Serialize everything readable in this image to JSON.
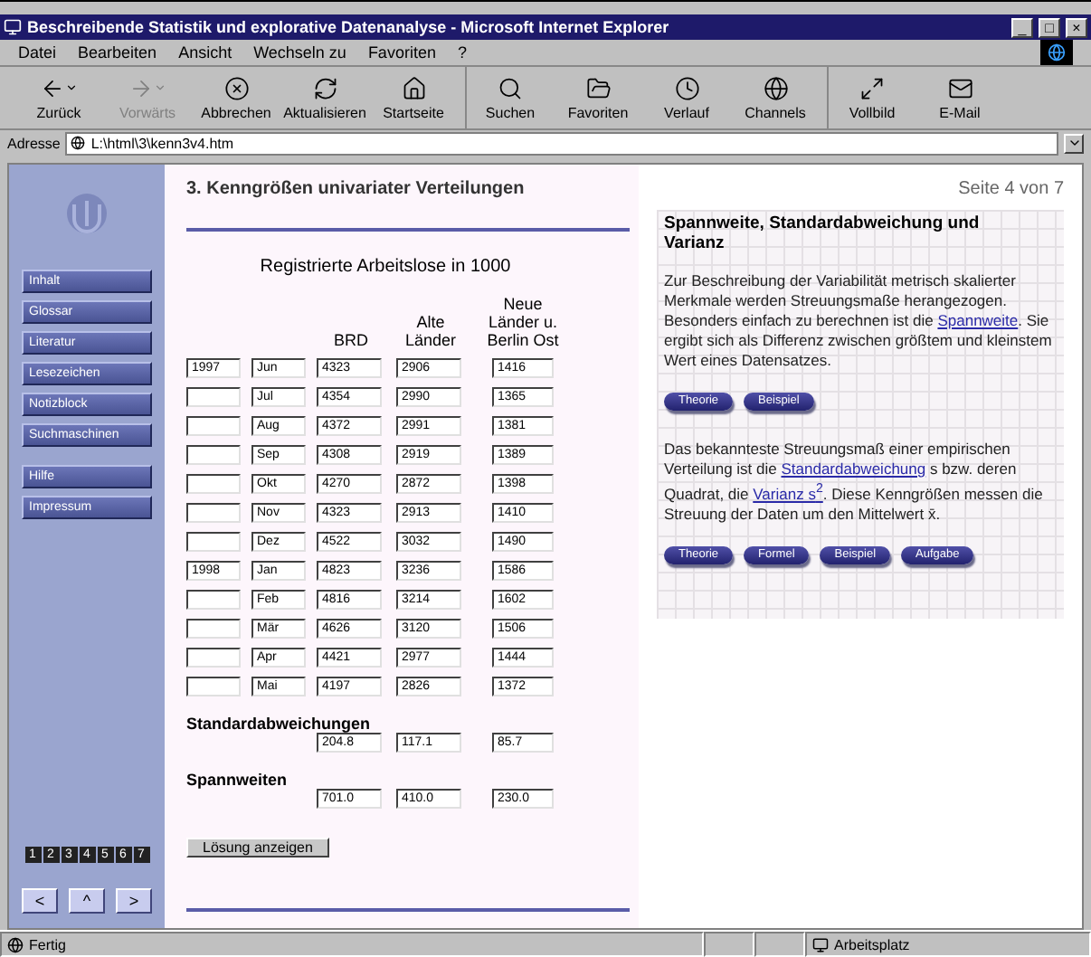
{
  "window": {
    "title": "Beschreibende Statistik und explorative Datenanalyse - Microsoft Internet Explorer",
    "controls": [
      "_",
      "□",
      "×"
    ]
  },
  "menu": [
    "Datei",
    "Bearbeiten",
    "Ansicht",
    "Wechseln zu",
    "Favoriten",
    "?"
  ],
  "toolbar": [
    {
      "label": "Zurück",
      "dropdown": true,
      "disabled": false,
      "group_start": false
    },
    {
      "label": "Vorwärts",
      "dropdown": true,
      "disabled": true,
      "group_start": false
    },
    {
      "label": "Abbrechen",
      "dropdown": false,
      "disabled": false,
      "group_start": false
    },
    {
      "label": "Aktualisieren",
      "dropdown": false,
      "disabled": false,
      "group_start": false
    },
    {
      "label": "Startseite",
      "dropdown": false,
      "disabled": false,
      "group_start": false
    },
    {
      "label": "Suchen",
      "dropdown": false,
      "disabled": false,
      "group_start": true
    },
    {
      "label": "Favoriten",
      "dropdown": false,
      "disabled": false,
      "group_start": false
    },
    {
      "label": "Verlauf",
      "dropdown": false,
      "disabled": false,
      "group_start": false
    },
    {
      "label": "Channels",
      "dropdown": false,
      "disabled": false,
      "group_start": false
    },
    {
      "label": "Vollbild",
      "dropdown": false,
      "disabled": false,
      "group_start": true
    },
    {
      "label": "E-Mail",
      "dropdown": false,
      "disabled": false,
      "group_start": false
    }
  ],
  "address": {
    "label": "Adresse",
    "value": "L:\\html\\3\\kenn3v4.htm"
  },
  "sidebar": {
    "items": [
      {
        "label": "Inhalt",
        "group_start": false
      },
      {
        "label": "Glossar",
        "group_start": false
      },
      {
        "label": "Literatur",
        "group_start": false
      },
      {
        "label": "Lesezeichen",
        "group_start": false
      },
      {
        "label": "Notizblock",
        "group_start": false
      },
      {
        "label": "Suchmaschinen",
        "group_start": false
      },
      {
        "label": "Hilfe",
        "group_start": true
      },
      {
        "label": "Impressum",
        "group_start": false
      }
    ],
    "chapters": [
      "1",
      "2",
      "3",
      "4",
      "5",
      "6",
      "7"
    ],
    "nav": [
      "<",
      "^",
      ">"
    ]
  },
  "main": {
    "heading": "3. Kenngrößen univariater Verteilungen",
    "table": {
      "title": "Registrierte Arbeitslose in 1000",
      "columns": [
        "BRD",
        "Alte Länder",
        "Neue Länder u. Berlin Ost"
      ],
      "rows": [
        {
          "year": "1997",
          "month": "Jun",
          "values": [
            "4323",
            "2906",
            "1416"
          ]
        },
        {
          "month": "Jul",
          "values": [
            "4354",
            "2990",
            "1365"
          ]
        },
        {
          "month": "Aug",
          "values": [
            "4372",
            "2991",
            "1381"
          ]
        },
        {
          "month": "Sep",
          "values": [
            "4308",
            "2919",
            "1389"
          ]
        },
        {
          "month": "Okt",
          "values": [
            "4270",
            "2872",
            "1398"
          ]
        },
        {
          "month": "Nov",
          "values": [
            "4323",
            "2913",
            "1410"
          ]
        },
        {
          "month": "Dez",
          "values": [
            "4522",
            "3032",
            "1490"
          ]
        },
        {
          "year": "1998",
          "month": "Jan",
          "values": [
            "4823",
            "3236",
            "1586"
          ]
        },
        {
          "month": "Feb",
          "values": [
            "4816",
            "3214",
            "1602"
          ]
        },
        {
          "month": "Mär",
          "values": [
            "4626",
            "3120",
            "1506"
          ]
        },
        {
          "month": "Apr",
          "values": [
            "4421",
            "2977",
            "1444"
          ]
        },
        {
          "month": "Mai",
          "values": [
            "4197",
            "2826",
            "1372"
          ]
        }
      ],
      "summaries": [
        {
          "label": "Standardabweichungen",
          "values": [
            "204.8",
            "117.1",
            "85.7"
          ]
        },
        {
          "label": "Spannweiten",
          "values": [
            "701.0",
            "410.0",
            "230.0"
          ]
        }
      ]
    },
    "button": "Lösung anzeigen"
  },
  "info": {
    "page": "Seite 4 von 7",
    "heading": "Spannweite, Standardabweichung und Varianz",
    "sections": [
      {
        "parts": [
          {
            "text": "Zur Beschreibung der Variabilität metrisch skalierter Merkmale werden Streuungsmaße herangezogen. Besonders einfach zu berechnen ist die ",
            "link": false
          },
          {
            "text": "Spannweite",
            "link": true
          },
          {
            "text": ". Sie ergibt sich als Differenz zwischen größtem und kleinstem Wert eines Datensatzes.",
            "link": false
          }
        ],
        "buttons": [
          "Theorie",
          "Beispiel"
        ]
      },
      {
        "parts": [
          {
            "text": "Das bekannteste Streuungsmaß einer empirischen Verteilung ist die ",
            "link": false
          },
          {
            "text": "Standardabweichung",
            "link": true
          },
          {
            "text": " s bzw. deren Quadrat, die ",
            "link": false
          },
          {
            "text": "Varianz s$^{2}$",
            "link": true
          },
          {
            "text": ". Diese Kenngrößen messen die Streuung der Daten um den Mittelwert x̄.",
            "link": false
          }
        ],
        "buttons": [
          "Theorie",
          "Formel",
          "Beispiel",
          "Aufgabe"
        ]
      }
    ]
  },
  "status": {
    "text": "Fertig",
    "zone": "Arbeitsplatz"
  }
}
